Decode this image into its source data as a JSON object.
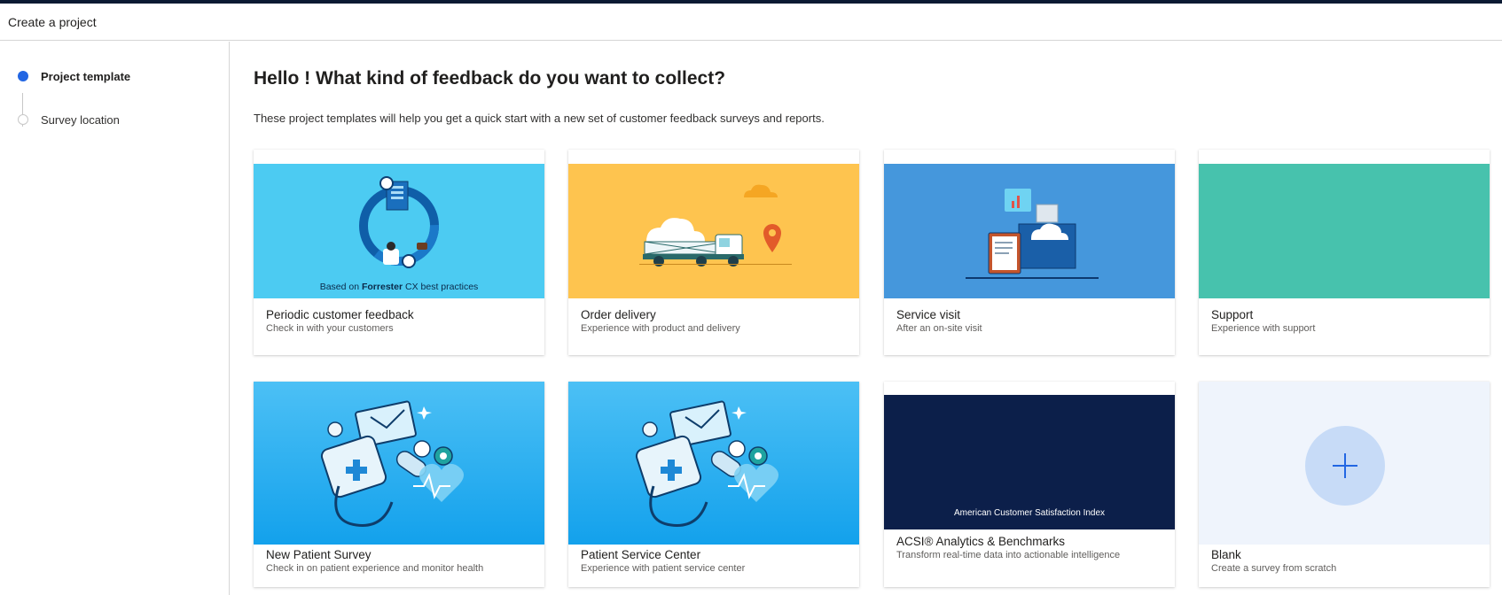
{
  "header": {
    "title": "Create a project"
  },
  "sidebar": {
    "steps": [
      {
        "label": "Project template",
        "state": "active"
      },
      {
        "label": "Survey location",
        "state": "inactive"
      }
    ]
  },
  "main": {
    "heading": "Hello ! What kind of feedback do you want to collect?",
    "subheading": "These project templates will help you get a quick start with a new set of customer feedback surveys and reports.",
    "cards": [
      {
        "title": "Periodic customer feedback",
        "desc": "Check in with your customers",
        "image_caption_prefix": "Based on ",
        "image_caption_brand": "Forrester",
        "image_caption_suffix": " CX best practices"
      },
      {
        "title": "Order delivery",
        "desc": "Experience with product and delivery"
      },
      {
        "title": "Service visit",
        "desc": "After an on-site visit"
      },
      {
        "title": "Support",
        "desc": "Experience with support"
      },
      {
        "title": "New Patient Survey",
        "desc": "Check in on patient experience and monitor health"
      },
      {
        "title": "Patient Service Center",
        "desc": "Experience with patient service center"
      },
      {
        "title": "ACSI® Analytics & Benchmarks",
        "desc": "Transform real-time data into actionable intelligence",
        "image_caption": "American Customer Satisfaction Index"
      },
      {
        "title": "Blank",
        "desc": "Create a survey from scratch"
      }
    ]
  },
  "colors": {
    "accent": "#2266e3",
    "periodic_bg": "#4ccbf2",
    "delivery_bg": "#fec44f",
    "service_bg": "#4597dc",
    "support_bg": "#47c2ad",
    "patient_bg": "#2aaef0",
    "acsi_bg": "#0c1f4a",
    "blank_bg": "#eff4fc"
  }
}
